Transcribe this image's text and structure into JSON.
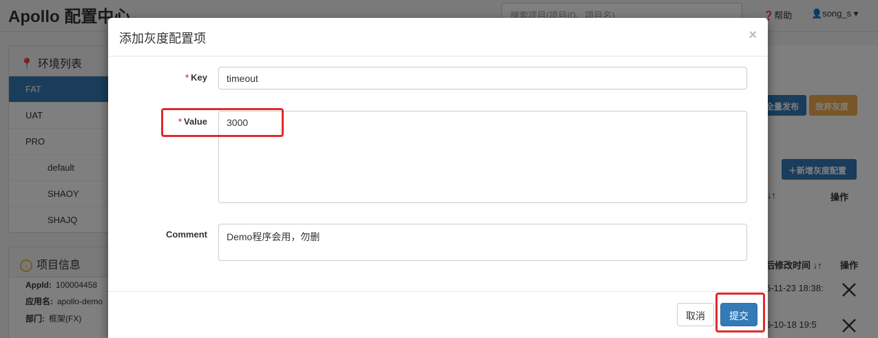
{
  "app": {
    "title": "Apollo 配置中心"
  },
  "header": {
    "search_placeholder": "搜索项目(项目ID、项目名)",
    "help": "帮助",
    "user": "song_s"
  },
  "env_panel": {
    "title": "环境列表",
    "items": [
      "FAT",
      "UAT",
      "PRO"
    ],
    "clusters": [
      "default",
      "SHAOY",
      "SHAJQ"
    ]
  },
  "info_panel": {
    "title": "项目信息",
    "appid_label": "AppId:",
    "appid_value": "100004458",
    "appname_label": "应用名:",
    "appname_value": "apollo-demo",
    "dept_label": "部门:",
    "dept_value": "框架(FX)"
  },
  "right_area": {
    "publish_btn": "全量发布",
    "abandon_btn": "放弃灰度",
    "new_gray_btn": "新增灰度配置",
    "col_sort": "↓↑",
    "col_op1": "操作",
    "col_modified": "后修改时间 ↓↑",
    "col_op2": "操作",
    "row1_time": "6-11-23 18:38:",
    "row2_time": "6-10-18 19:5"
  },
  "modal": {
    "title": "添加灰度配置项",
    "close": "×",
    "key_label": "Key",
    "key_value": "timeout",
    "value_label": "Value",
    "value_value": "3000",
    "comment_label": "Comment",
    "comment_value": "Demo程序会用，勿删",
    "required_mark": "*",
    "cancel": "取消",
    "submit": "提交"
  }
}
